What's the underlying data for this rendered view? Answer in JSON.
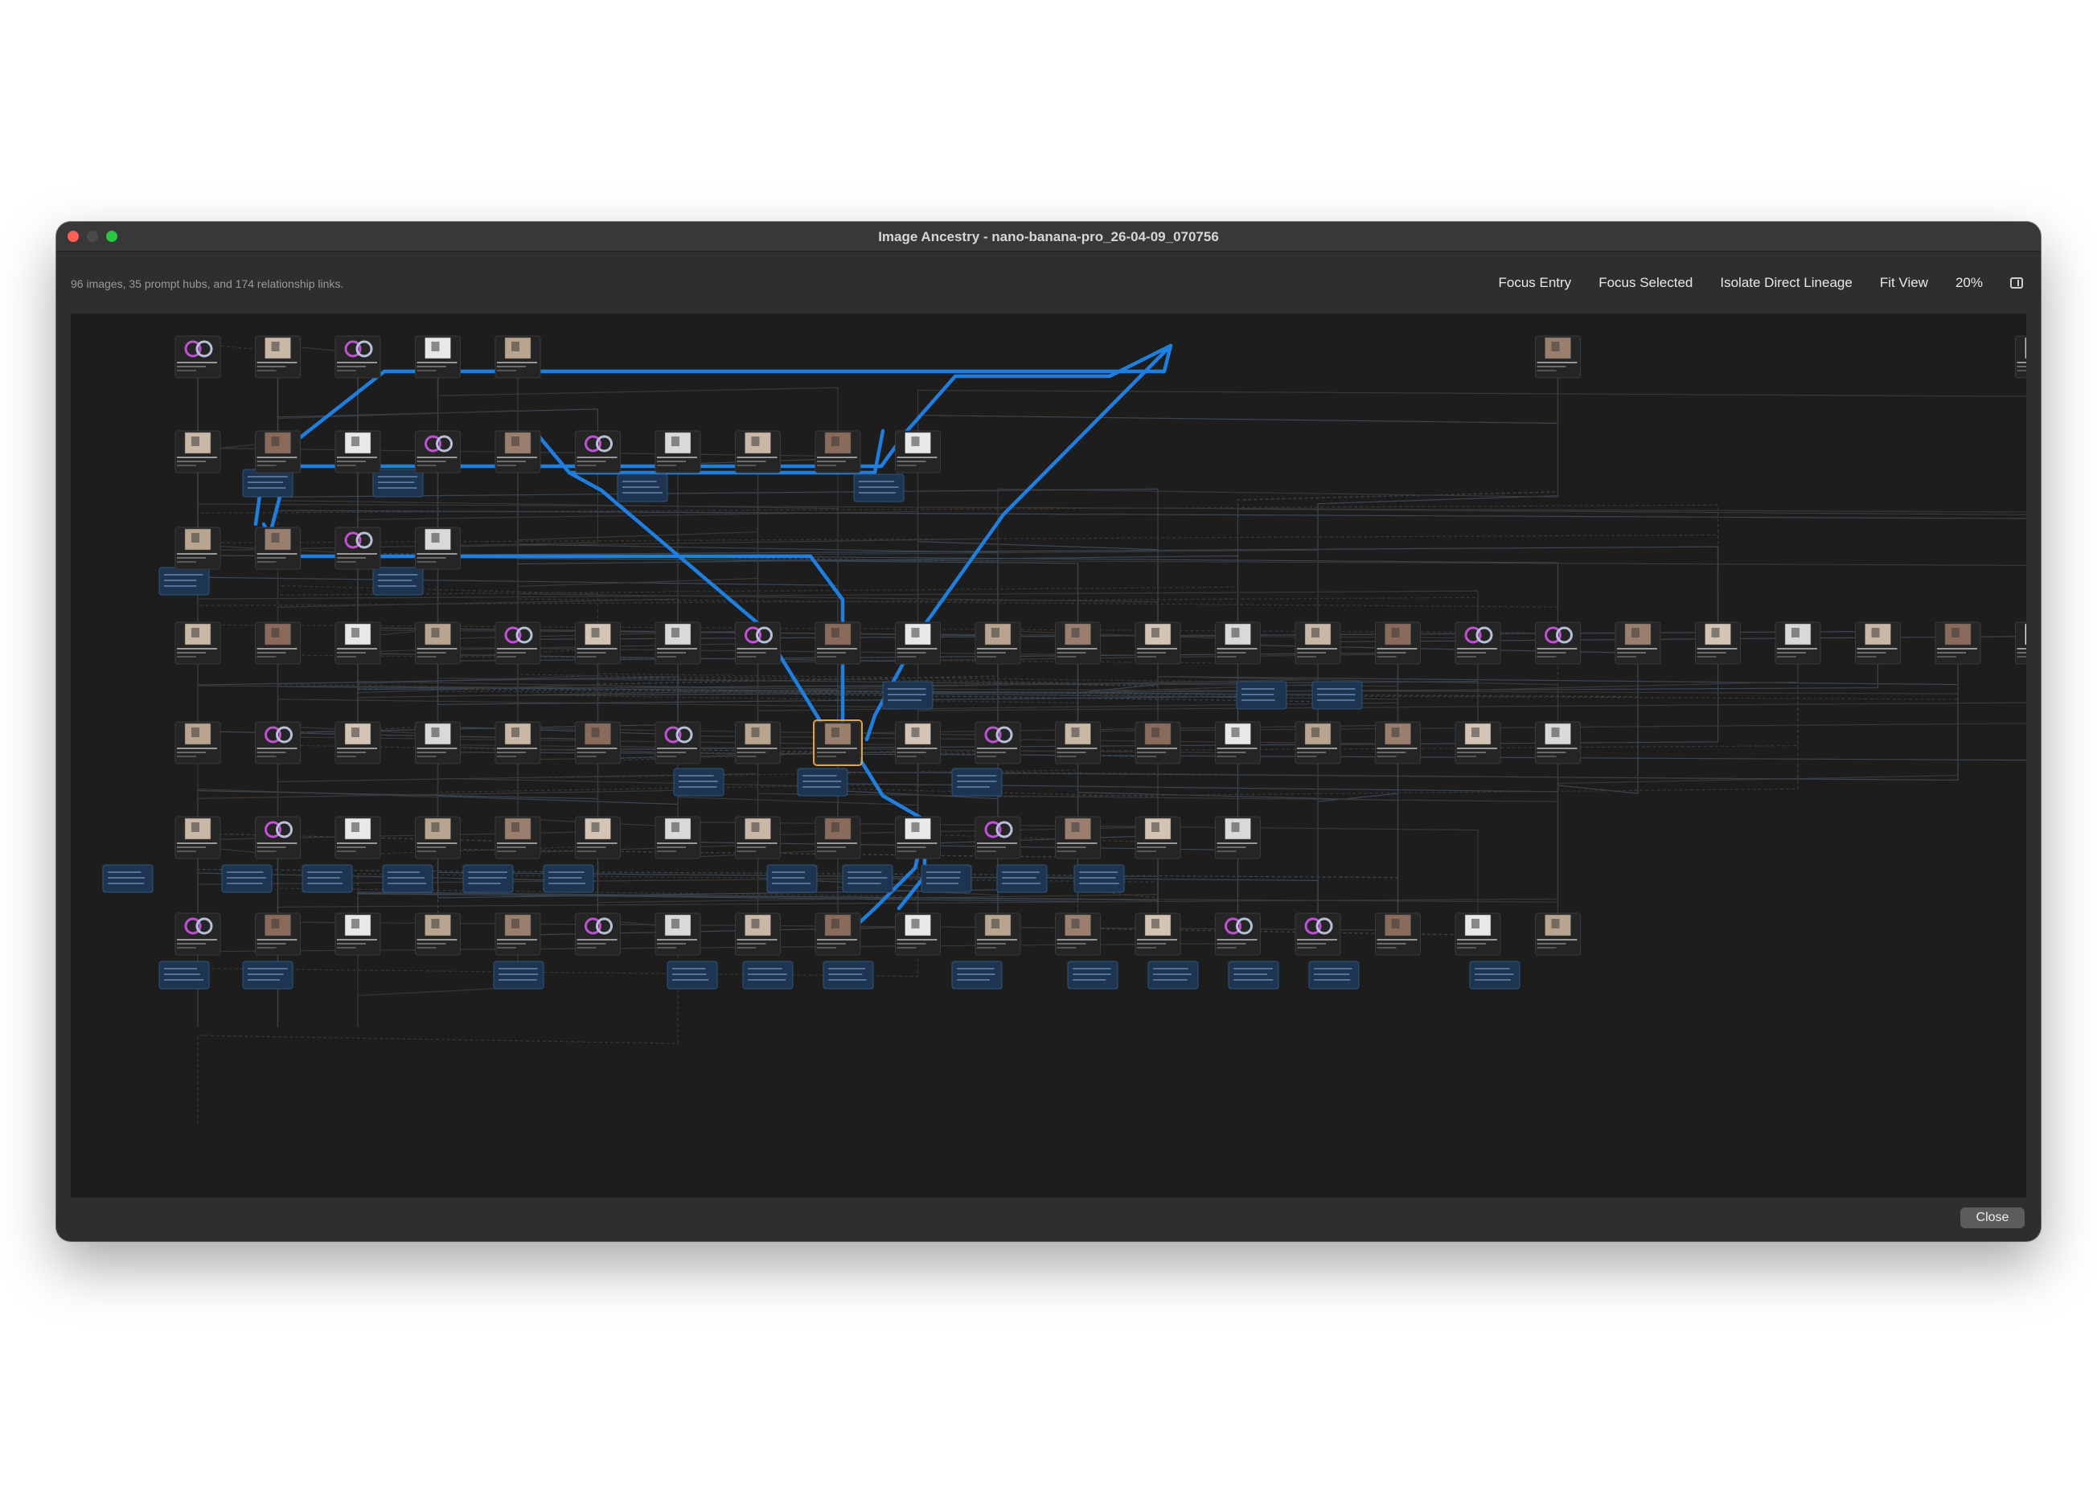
{
  "window": {
    "title": "Image Ancestry - nano-banana-pro_26-04-09_070756"
  },
  "summary": "96 images, 35 prompt hubs, and 174 relationship links.",
  "toolbar": {
    "focus_entry": "Focus Entry",
    "focus_selected": "Focus Selected",
    "isolate_direct_lineage": "Isolate Direct Lineage",
    "fit_view": "Fit View",
    "zoom": "20%"
  },
  "footer": {
    "close_label": "Close"
  },
  "colors": {
    "canvas": "#1d1d1d",
    "window": "#2e2e2e",
    "lineage_highlight": "#1f7fe0",
    "prompt_hub": "#1d3550",
    "prompt_hub_border": "#2f5680"
  }
}
